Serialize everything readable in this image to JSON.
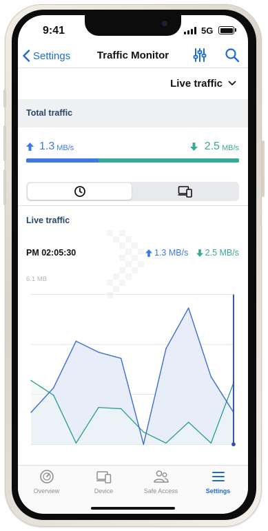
{
  "status_bar": {
    "time": "9:41",
    "network": "5G"
  },
  "nav": {
    "back_label": "Settings",
    "title": "Traffic Monitor",
    "filter_icon": "sliders-icon",
    "search_icon": "search-icon"
  },
  "mode_dropdown": {
    "selected": "Live traffic"
  },
  "total_traffic": {
    "header": "Total traffic",
    "upload": {
      "value": "1.3",
      "unit": "MB/s"
    },
    "download": {
      "value": "2.5",
      "unit": "MB/s"
    },
    "upload_share": 0.34
  },
  "segmented_control": {
    "options": [
      "clock-icon",
      "devices-icon"
    ],
    "selected": 0
  },
  "live_traffic": {
    "header": "Live traffic",
    "timestamp": "PM 02:05:30",
    "upload_label": "1.3 MB/s",
    "download_label": "2.5 MB/s"
  },
  "chart_data": {
    "type": "area",
    "title": "",
    "xlabel": "",
    "ylabel": "",
    "ymax_label": "6.1 MB",
    "ylim": [
      0,
      6.1
    ],
    "x": [
      0,
      1,
      2,
      3,
      4,
      5,
      6,
      7,
      8,
      9
    ],
    "grid": true,
    "series": [
      {
        "values": [
          1.3,
          2.3,
          4.2,
          3.75,
          3.5,
          0.0,
          3.9,
          5.55,
          2.75,
          1.3
        ]
      },
      {
        "values": [
          2.6,
          2.0,
          0.05,
          1.5,
          1.45,
          0.5,
          0.05,
          0.9,
          0.05,
          2.5
        ]
      }
    ],
    "colors": {
      "upload": "#3d6fd1",
      "upload_fill": "#e8eef9",
      "download": "#2a9d8f"
    }
  },
  "tab_bar": {
    "items": [
      {
        "label": "Overview",
        "icon": "gauge-icon"
      },
      {
        "label": "Device",
        "icon": "devices-icon"
      },
      {
        "label": "Safe Access",
        "icon": "people-icon"
      },
      {
        "label": "Settings",
        "icon": "menu-icon"
      }
    ],
    "active_index": 3
  },
  "colors": {
    "accent": "#1e6ad6",
    "upload": "#3d7ae0",
    "download": "#3aa896",
    "section_text": "#23466b"
  }
}
